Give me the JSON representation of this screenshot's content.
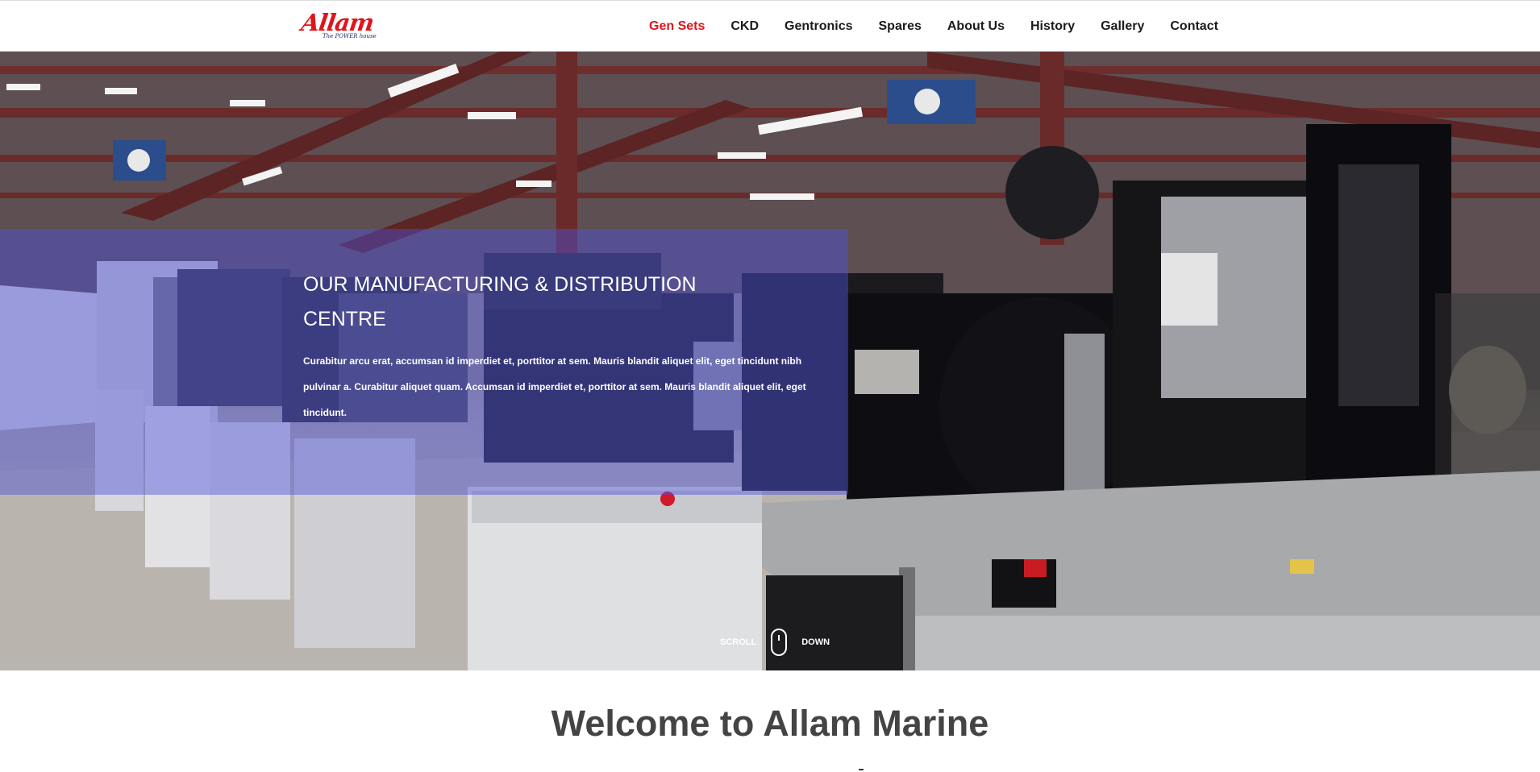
{
  "logo": {
    "name": "Allam",
    "tagline": "The POWER house"
  },
  "nav": {
    "items": [
      "Gen Sets",
      "CKD",
      "Gentronics",
      "Spares",
      "About Us",
      "History",
      "Gallery",
      "Contact"
    ],
    "active_index": 0
  },
  "hero": {
    "title": "OUR MANUFACTURING & DISTRIBUTION CENTRE",
    "text": "Curabitur arcu erat, accumsan id imperdiet et, porttitor at sem. Mauris blandit aliquet elit, eget tincidunt nibh pulvinar a. Curabitur aliquet quam. Accumsan id imperdiet et, porttitor at sem. Mauris blandit aliquet elit, eget tincidunt.",
    "scroll_left": "SCROLL",
    "scroll_right": "DOWN",
    "image_subject": "generator sets on factory floor"
  },
  "welcome": {
    "title": "Welcome to Allam Marine"
  },
  "colors": {
    "accent": "#e0141b",
    "nav_text": "#1b1b1b",
    "overlay": "#4e50dc",
    "heading": "#444444"
  }
}
